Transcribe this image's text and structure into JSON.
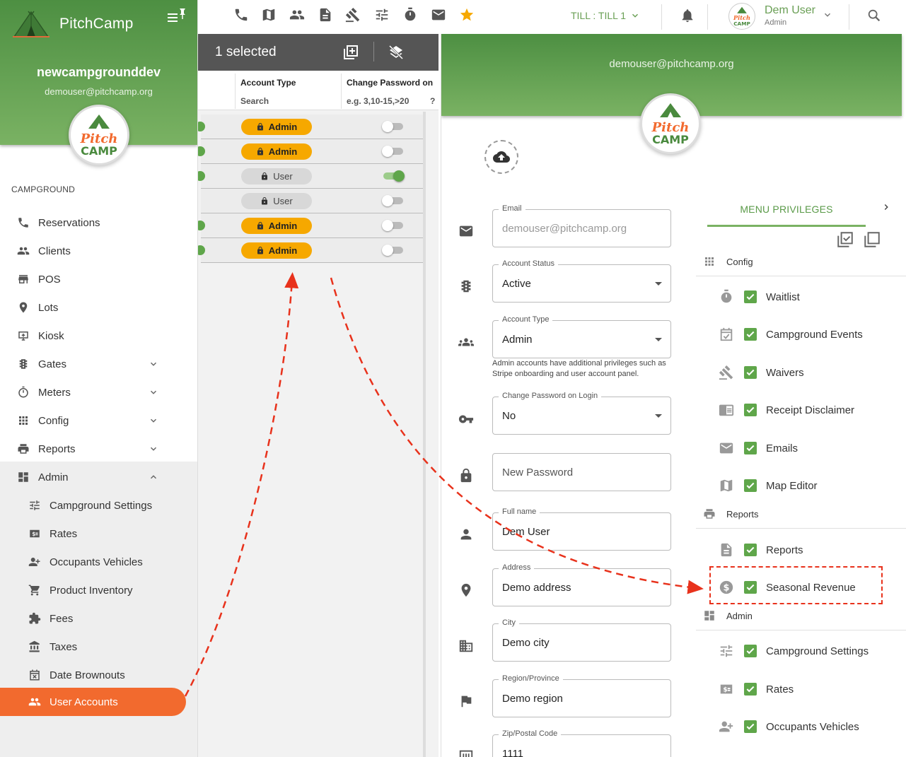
{
  "app": {
    "name": "PitchCamp"
  },
  "sidebar": {
    "campground_name": "newcampgrounddev",
    "email": "demouser@pitchcamp.org",
    "section_label": "CAMPGROUND",
    "logo_text_top": "Pitch",
    "logo_text_bottom": "CAMP",
    "items": [
      {
        "label": "Reservations",
        "icon": "phone-icon"
      },
      {
        "label": "Clients",
        "icon": "people-icon"
      },
      {
        "label": "POS",
        "icon": "store-icon"
      },
      {
        "label": "Lots",
        "icon": "pin-icon"
      },
      {
        "label": "Kiosk",
        "icon": "kiosk-icon"
      },
      {
        "label": "Gates",
        "icon": "traffic-light-icon",
        "expandable": true
      },
      {
        "label": "Meters",
        "icon": "timer-icon",
        "expandable": true
      },
      {
        "label": "Config",
        "icon": "grid-icon",
        "expandable": true
      },
      {
        "label": "Reports",
        "icon": "printer-icon",
        "expandable": true
      },
      {
        "label": "Admin",
        "icon": "dashboard-icon",
        "expanded": true
      }
    ],
    "admin_items": [
      {
        "label": "Campground Settings",
        "icon": "tune-icon"
      },
      {
        "label": "Rates",
        "icon": "money-icon"
      },
      {
        "label": "Occupants Vehicles",
        "icon": "person-add-icon"
      },
      {
        "label": "Product Inventory",
        "icon": "cart-icon"
      },
      {
        "label": "Fees",
        "icon": "puzzle-icon"
      },
      {
        "label": "Taxes",
        "icon": "bank-icon"
      },
      {
        "label": "Date Brownouts",
        "icon": "calendar-x-icon"
      },
      {
        "label": "User Accounts",
        "icon": "people-icon",
        "active": true
      }
    ]
  },
  "topbar": {
    "icons": [
      "phone-icon",
      "map-icon",
      "people-icon",
      "receipt-icon",
      "gavel-icon",
      "tune-icon",
      "timer-icon",
      "mail-icon",
      "star-icon"
    ],
    "till_label": "TILL : TILL 1",
    "user_name": "Dem User",
    "user_role": "Admin"
  },
  "table": {
    "selected_text": "1 selected",
    "columns": [
      {
        "header": "Account Type",
        "filter": "Search"
      },
      {
        "header": "Change Password on",
        "filter": "e.g. 3,10-15,>20"
      }
    ],
    "filter_suffix": "?",
    "rows": [
      {
        "account_type": "Admin",
        "change_password": false
      },
      {
        "account_type": "Admin",
        "change_password": false
      },
      {
        "account_type": "User",
        "change_password": true
      },
      {
        "account_type": "User",
        "change_password": false
      },
      {
        "account_type": "Admin",
        "change_password": false
      },
      {
        "account_type": "Admin",
        "change_password": false
      }
    ]
  },
  "detail": {
    "email_header": "demouser@pitchcamp.org",
    "fields": {
      "email": {
        "label": "Email",
        "value": "demouser@pitchcamp.org"
      },
      "account_status": {
        "label": "Account Status",
        "value": "Active"
      },
      "account_type": {
        "label": "Account Type",
        "value": "Admin"
      },
      "account_type_hint": "Admin accounts have additional privileges such as Stripe onboarding and user account panel.",
      "change_password": {
        "label": "Change Password on Login",
        "value": "No"
      },
      "new_password": {
        "placeholder": "New Password"
      },
      "full_name": {
        "label": "Full name",
        "value": "Dem User"
      },
      "address": {
        "label": "Address",
        "value": "Demo address"
      },
      "city": {
        "label": "City",
        "value": "Demo city"
      },
      "region": {
        "label": "Region/Province",
        "value": "Demo region"
      },
      "zip": {
        "label": "Zip/Postal Code",
        "value": "1111"
      }
    },
    "privileges": {
      "tab_label": "MENU PRIVILEGES",
      "groups": {
        "config": "Config",
        "reports": "Reports",
        "admin": "Admin"
      },
      "config_items": [
        "Waitlist",
        "Campground Events",
        "Waivers",
        "Receipt Disclaimer",
        "Emails",
        "Map Editor"
      ],
      "reports_items": [
        "Reports",
        "Seasonal Revenue"
      ],
      "admin_items": [
        "Campground Settings",
        "Rates",
        "Occupants Vehicles"
      ]
    }
  },
  "colors": {
    "brand_green": "#5fa64a",
    "accent_orange": "#f26a2e",
    "admin_chip": "#f6a800",
    "annotation_red": "#e8321c"
  }
}
